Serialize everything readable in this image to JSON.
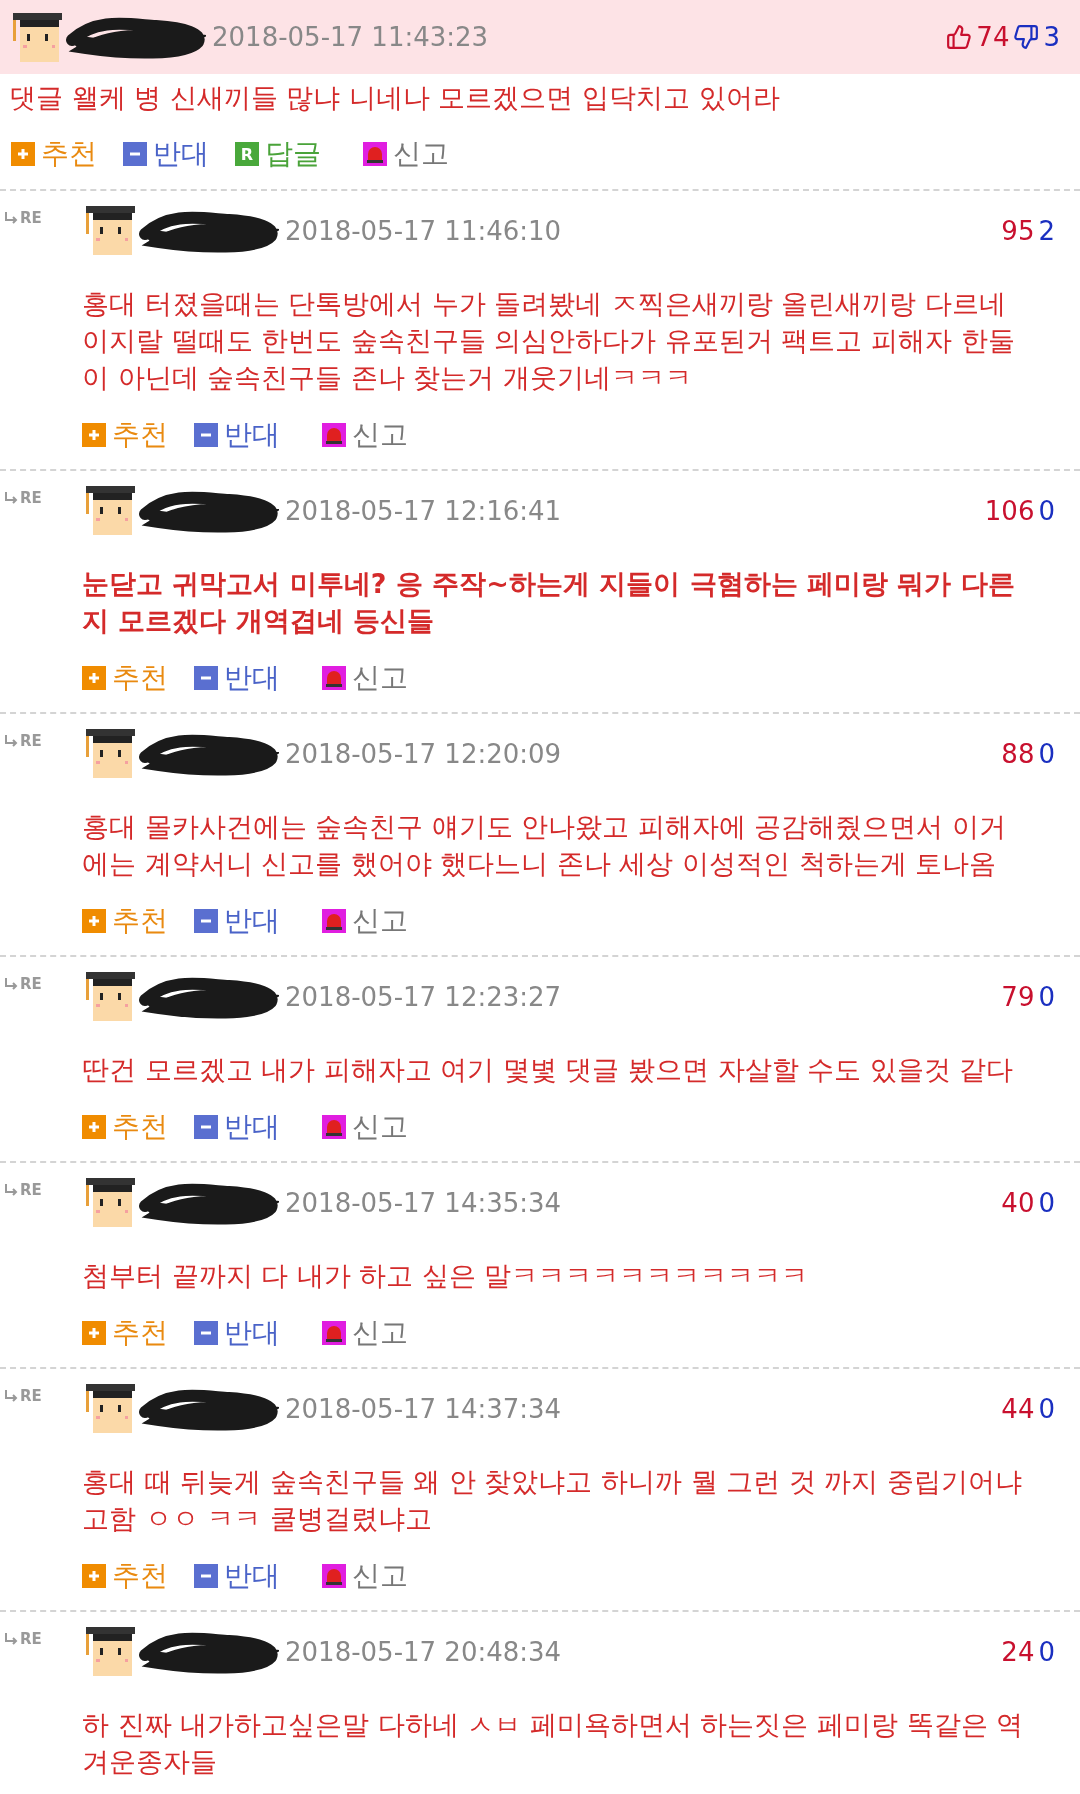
{
  "comments": [
    {
      "kind": "main",
      "date": "2018-05-17 11:43:23",
      "up": "74",
      "down": "3",
      "bold": false,
      "text": "댓글 왤케 병 신새끼들 많냐 니네나 모르겠으면 입닥치고 있어라",
      "actions": [
        {
          "kind": "up",
          "label": "추천"
        },
        {
          "kind": "down",
          "label": "반대"
        },
        {
          "kind": "reply",
          "badge": "R",
          "label": "답글"
        },
        {
          "kind": "report",
          "label": "신고"
        }
      ]
    },
    {
      "kind": "reply",
      "marker": "RE",
      "date": "2018-05-17 11:46:10",
      "up": "95",
      "down": "2",
      "bold": false,
      "text": "홍대 터졌을때는 단톡방에서 누가 돌려봤네 ㅈ찍은새끼랑 올린새끼랑 다르네 이지랄 떨때도 한번도 숲속친구들 의심안하다가 유포된거 팩트고 피해자 한둘이 아닌데 숲속친구들 존나 찾는거 개웃기네ㅋㅋㅋ",
      "actions": [
        {
          "kind": "up",
          "label": "추천"
        },
        {
          "kind": "down",
          "label": "반대"
        },
        {
          "kind": "report",
          "label": "신고"
        }
      ]
    },
    {
      "kind": "reply",
      "marker": "RE",
      "date": "2018-05-17 12:16:41",
      "up": "106",
      "down": "0",
      "bold": true,
      "text": "눈닫고 귀막고서 미투네? 응 주작~하는게 지들이 극혐하는 페미랑 뭐가 다른지 모르겠다 개역겹네 등신들",
      "actions": [
        {
          "kind": "up",
          "label": "추천"
        },
        {
          "kind": "down",
          "label": "반대"
        },
        {
          "kind": "report",
          "label": "신고"
        }
      ]
    },
    {
      "kind": "reply",
      "marker": "RE",
      "date": "2018-05-17 12:20:09",
      "up": "88",
      "down": "0",
      "bold": false,
      "text": "홍대 몰카사건에는 숲속친구 얘기도 안나왔고 피해자에 공감해줬으면서 이거에는 계약서니 신고를 했어야 했다느니 존나 세상 이성적인 척하는게 토나옴",
      "actions": [
        {
          "kind": "up",
          "label": "추천"
        },
        {
          "kind": "down",
          "label": "반대"
        },
        {
          "kind": "report",
          "label": "신고"
        }
      ]
    },
    {
      "kind": "reply",
      "marker": "RE",
      "date": "2018-05-17 12:23:27",
      "up": "79",
      "down": "0",
      "bold": false,
      "text": "딴건 모르겠고 내가 피해자고 여기 몇볓 댓글 봤으면 자살할 수도 있을것 같다",
      "actions": [
        {
          "kind": "up",
          "label": "추천"
        },
        {
          "kind": "down",
          "label": "반대"
        },
        {
          "kind": "report",
          "label": "신고"
        }
      ]
    },
    {
      "kind": "reply",
      "marker": "RE",
      "date": "2018-05-17 14:35:34",
      "up": "40",
      "down": "0",
      "bold": false,
      "text": "첨부터 끝까지 다 내가 하고 싶은 말ㅋㅋㅋㅋㅋㅋㅋㅋㅋㅋㅋ",
      "actions": [
        {
          "kind": "up",
          "label": "추천"
        },
        {
          "kind": "down",
          "label": "반대"
        },
        {
          "kind": "report",
          "label": "신고"
        }
      ]
    },
    {
      "kind": "reply",
      "marker": "RE",
      "date": "2018-05-17 14:37:34",
      "up": "44",
      "down": "0",
      "bold": false,
      "text": "홍대 때 뒤늦게 숲속친구들 왜 안 찾았냐고 하니까 뭘 그런 것 까지 중립기어냐 고함 ㅇㅇ ㅋㅋ 쿨병걸렸냐고",
      "actions": [
        {
          "kind": "up",
          "label": "추천"
        },
        {
          "kind": "down",
          "label": "반대"
        },
        {
          "kind": "report",
          "label": "신고"
        }
      ]
    },
    {
      "kind": "reply",
      "marker": "RE",
      "date": "2018-05-17 20:48:34",
      "up": "24",
      "down": "0",
      "bold": false,
      "text": "하 진짜 내가하고싶은말 다하네 ㅅㅂ 페미욕하면서 하는짓은 페미랑 똑같은 역겨운종자들"
    }
  ]
}
